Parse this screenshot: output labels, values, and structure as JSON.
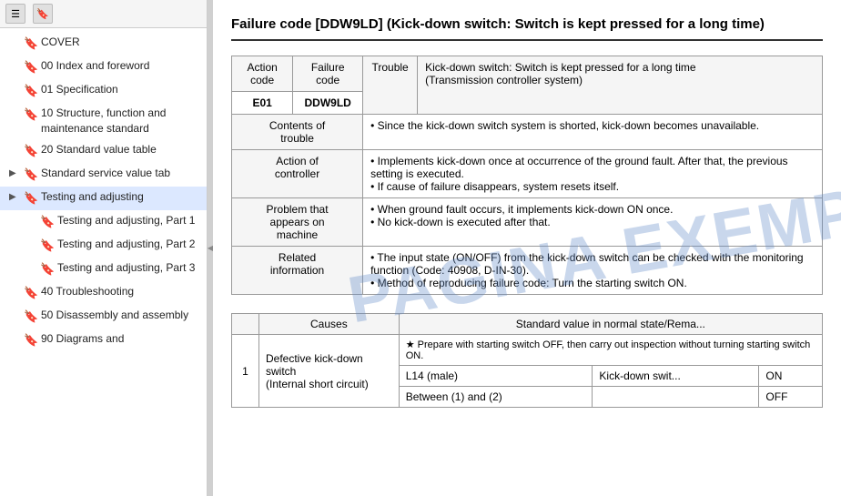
{
  "sidebar": {
    "toolbar": {
      "menu_icon": "☰",
      "bookmark_icon": "🔖"
    },
    "items": [
      {
        "id": "cover",
        "label": "COVER",
        "indent": 0,
        "expandable": false
      },
      {
        "id": "00-index",
        "label": "00 Index and foreword",
        "indent": 0,
        "expandable": false
      },
      {
        "id": "01-spec",
        "label": "01 Specification",
        "indent": 0,
        "expandable": false
      },
      {
        "id": "10-structure",
        "label": "10 Structure, function and maintenance standard",
        "indent": 0,
        "expandable": false
      },
      {
        "id": "20-standard",
        "label": "20 Standard value table",
        "indent": 0,
        "expandable": false
      },
      {
        "id": "standard-service",
        "label": "Standard service value tab",
        "indent": 0,
        "expandable": true
      },
      {
        "id": "testing1",
        "label": "Testing and adjusting",
        "indent": 0,
        "expandable": true,
        "active": true
      },
      {
        "id": "testing-part1",
        "label": "Testing and adjusting, Part 1",
        "indent": 1,
        "expandable": false
      },
      {
        "id": "testing-part2",
        "label": "Testing and adjusting, Part 2",
        "indent": 1,
        "expandable": false
      },
      {
        "id": "testing-part3",
        "label": "Testing and adjusting, Part 3",
        "indent": 1,
        "expandable": false
      },
      {
        "id": "40-troubleshooting",
        "label": "40 Troubleshooting",
        "indent": 0,
        "expandable": false
      },
      {
        "id": "50-disassembly",
        "label": "50 Disassembly and assembly",
        "indent": 0,
        "expandable": false
      },
      {
        "id": "90-diagrams",
        "label": "90 Diagrams and",
        "indent": 0,
        "expandable": false
      }
    ]
  },
  "main": {
    "title": "Failure code [DDW9LD] (Kick-down switch: Switch is kept pressed for a long time)",
    "title_short": "Failure code [DDW9LD] (Kick-down switch: Switch is ke...\nlong time)",
    "table1": {
      "headers": [
        "Action code",
        "Failure code",
        "Trouble"
      ],
      "action_code": "E01",
      "failure_code": "DDW9LD",
      "trouble_desc": "Kick-down switch: Switch is kept pressed for a long time (Transmission controller system)",
      "rows": [
        {
          "label": "Contents of trouble",
          "content": "Since the kick-down switch system is shorted, kick-down becomes unavailable."
        },
        {
          "label": "Action of controller",
          "content": "Implements kick-down once at occurrence of the ground fault. After that, the previous setting is executed.\nIf cause of failure disappears, system resets itself."
        },
        {
          "label": "Problem that appears on machine",
          "content": "When ground fault occurs, it implements kick-down ON once.\nNo kick-down is executed after that."
        },
        {
          "label": "Related information",
          "content_lines": [
            "The input state (ON/OFF) from the kick-down switch can be checked with the monitoring function (Code: 40908, D-IN-30).",
            "Method of reproducing failure code: Turn the starting switch ON."
          ]
        }
      ]
    },
    "table2": {
      "headers": [
        "Causes",
        "Standard value in normal state/Rema..."
      ],
      "rows": [
        {
          "num": "1",
          "cause": "Defective kick-down switch (Internal short circuit)",
          "sub_rows": [
            {
              "condition": "★ Prepare with starting switch OFF, then carry out inspection without turning starting switch ON.",
              "label1": "L14 (male)",
              "label2": "Kick-down swit...",
              "label3": "Between (1) and (2)",
              "val1": "ON",
              "val2": "OFF"
            }
          ]
        }
      ]
    },
    "watermark": "PAGINA EXEMPLU"
  }
}
